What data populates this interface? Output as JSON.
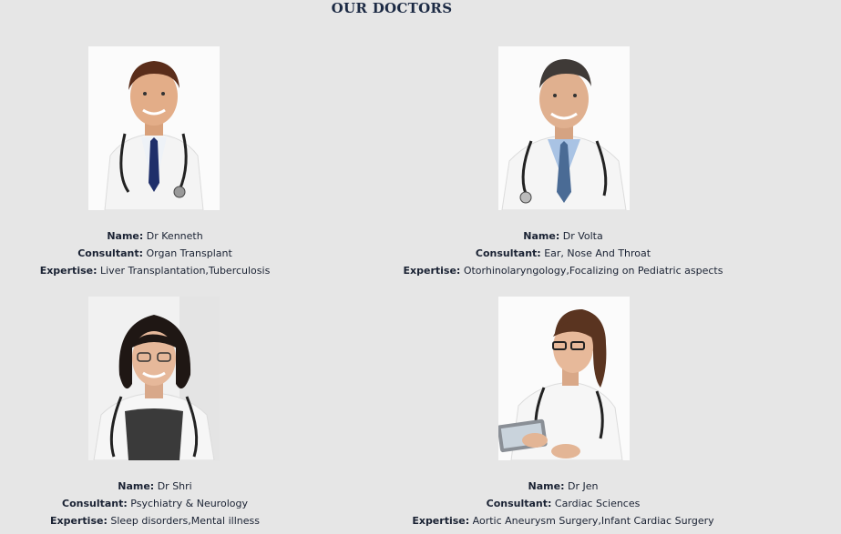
{
  "page": {
    "title": "OUR DOCTORS"
  },
  "labels": {
    "name": "Name:",
    "consultant": "Consultant:",
    "expertise": "Expertise:"
  },
  "doctors": [
    {
      "name": "Dr Kenneth",
      "consultant": "Organ Transplant",
      "expertise": "Liver Transplantation,Tuberculosis",
      "photo_icon": "male-doctor-portrait"
    },
    {
      "name": "Dr Volta",
      "consultant": "Ear, Nose And Throat",
      "expertise": "Otorhinolaryngology,Focalizing on Pediatric aspects",
      "photo_icon": "male-doctor-portrait"
    },
    {
      "name": "Dr Shri",
      "consultant": "Psychiatry & Neurology",
      "expertise": "Sleep disorders,Mental illness",
      "photo_icon": "female-doctor-portrait"
    },
    {
      "name": "Dr Jen",
      "consultant": "Cardiac Sciences",
      "expertise": "Aortic Aneurysm Surgery,Infant Cardiac Surgery",
      "photo_icon": "female-doctor-portrait"
    }
  ]
}
